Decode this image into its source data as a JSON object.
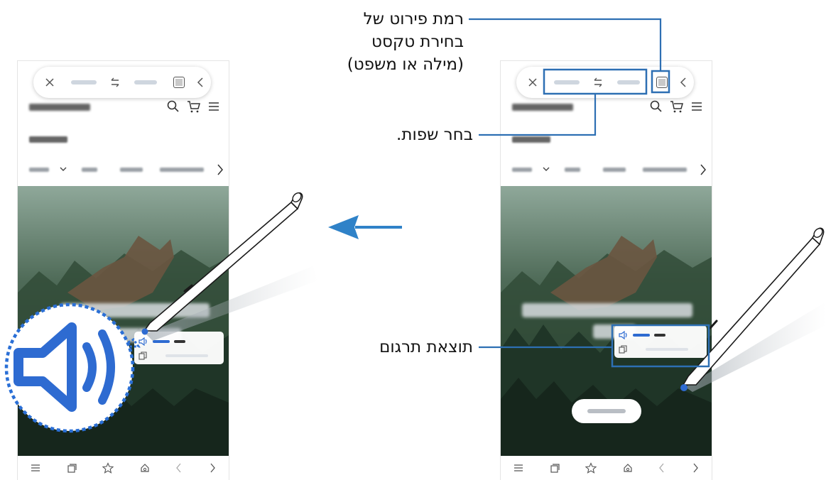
{
  "callouts": {
    "detail_level_line1": "רמת פירוט של",
    "detail_level_line2": "בחירת טקסט",
    "detail_level_line3": "(מילה או משפט)",
    "choose_languages": "בחר שפות.",
    "translation_result": "תוצאת תרגום"
  },
  "icons": {
    "direction_arrow": "left-arrow-icon",
    "speaker": "speaker-icon",
    "swap": "swap-languages-icon",
    "s_pen": "s-pen-icon"
  },
  "colors": {
    "callout_line": "#2d6fb3",
    "arrow": "#2f82c8",
    "magnifier_ring": "#2a6fd6",
    "speaker_icon": "#2e6bd1",
    "pen_body": "#ffffff"
  }
}
